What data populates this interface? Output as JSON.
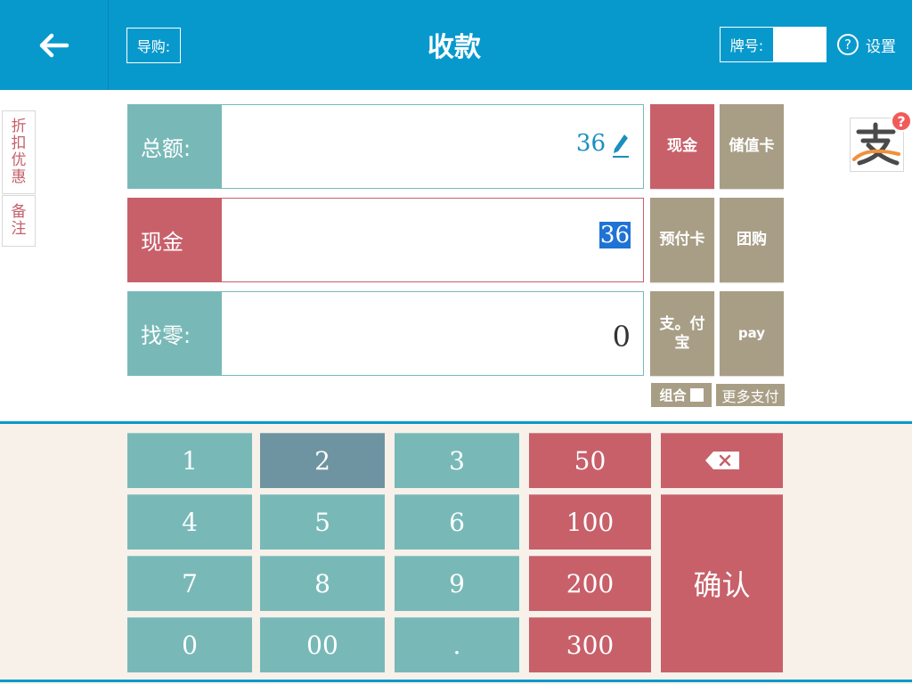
{
  "header": {
    "title": "收款",
    "guide_label": "导购:",
    "plate_label": "牌号:",
    "plate_value": "",
    "settings_label": "设置",
    "back_icon": "arrow-left-icon",
    "help_icon": "question-circle-icon"
  },
  "side_tabs": {
    "discount": [
      "折",
      "扣",
      "优",
      "惠"
    ],
    "note": [
      "备",
      "注"
    ]
  },
  "rows": {
    "total": {
      "label": "总额:",
      "value": "36"
    },
    "cash": {
      "label": "现金",
      "value": "36"
    },
    "change": {
      "label": "找零:",
      "value": "0"
    }
  },
  "payment_methods": {
    "cash": "现金",
    "stored_value_card": "储值卡",
    "prepaid_card": "预付卡",
    "group_buy": "团购",
    "alipay_line1": "支。付",
    "alipay_line2": "宝",
    "pay": "pay",
    "combo": "组合",
    "more": "更多支付"
  },
  "alipay_badge": "?",
  "keypad": {
    "digits": [
      "1",
      "2",
      "3",
      "4",
      "5",
      "6",
      "7",
      "8",
      "9",
      "0",
      "00",
      "."
    ],
    "quick_amounts": [
      "50",
      "100",
      "200",
      "300"
    ],
    "confirm": "确认",
    "delete_icon": "backspace-icon"
  },
  "colors": {
    "header_blue": "#0899cc",
    "teal": "#78b9b8",
    "red": "#c8606a",
    "khaki": "#a89e86",
    "pressed_key": "#6e94a1",
    "keypad_bg": "#f7f1ea"
  }
}
